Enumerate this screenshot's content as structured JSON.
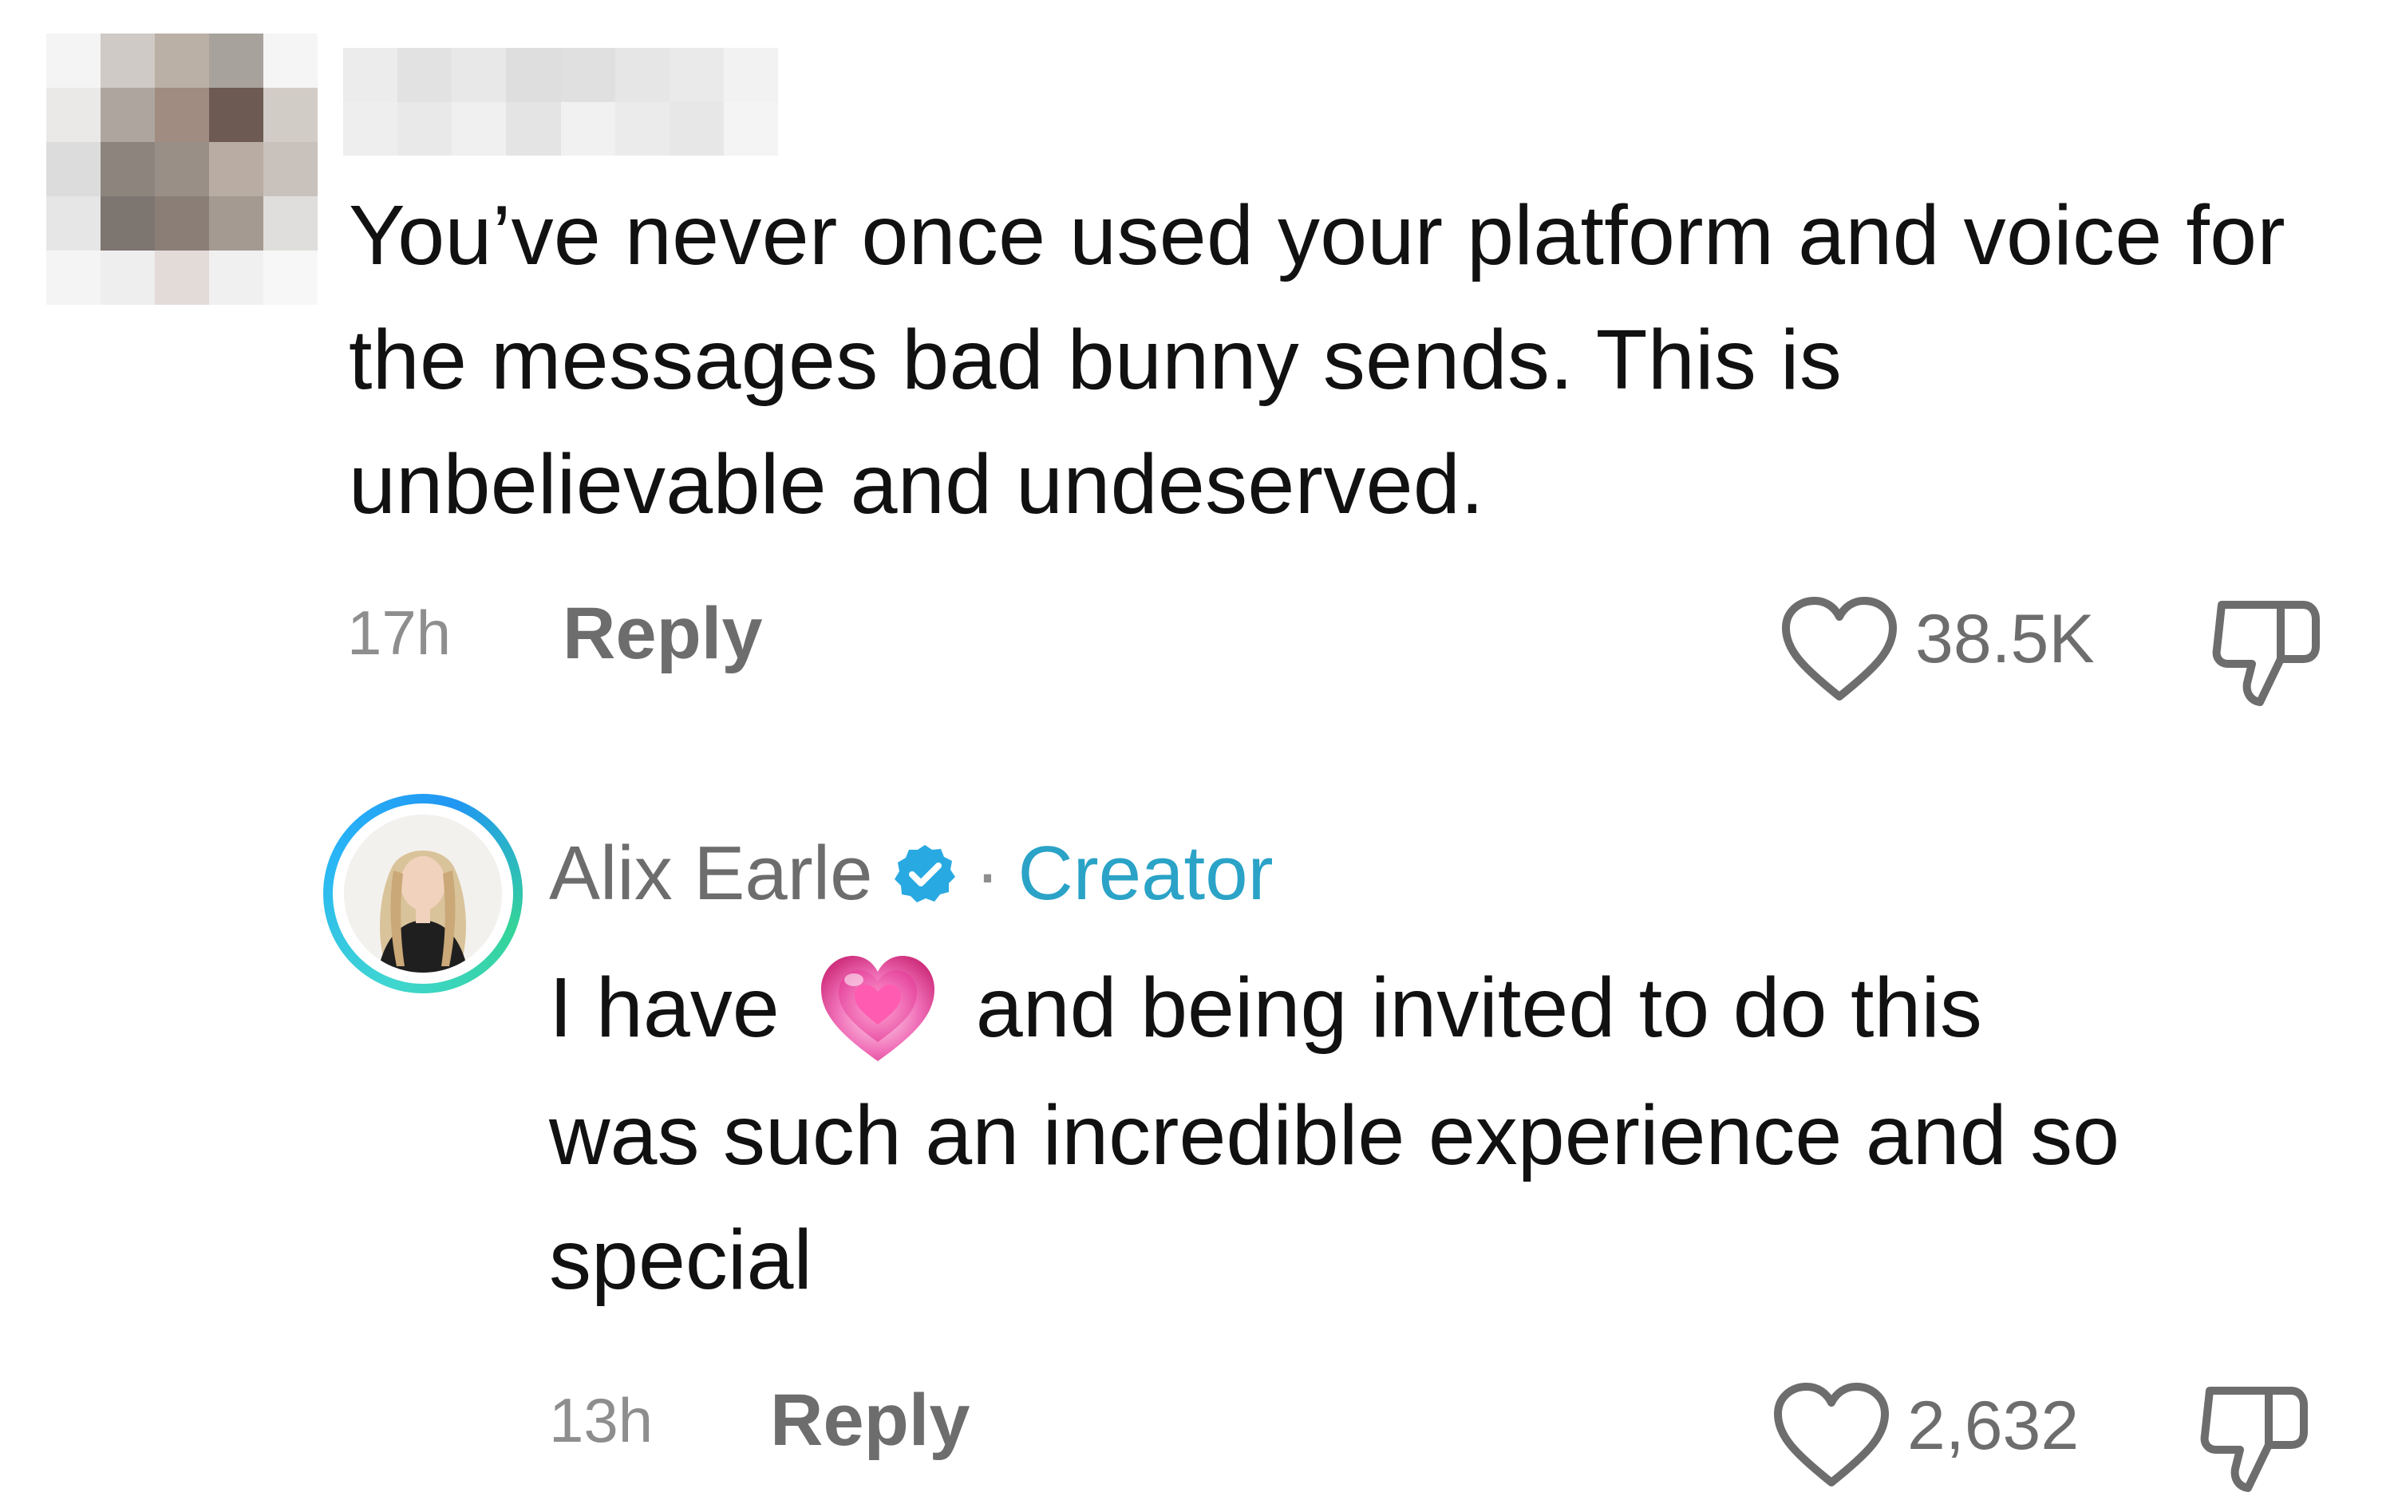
{
  "comments": [
    {
      "author": "",
      "text": "You’ve never once used your platform and voice for the messages bad bunny sends. This is unbelievable and undeserved.",
      "time": "17h",
      "reply_label": "Reply",
      "like_count": "38.5K"
    },
    {
      "author": "Alix Earle",
      "verified": true,
      "badge_label": "Creator",
      "separator": "·",
      "text_before_emoji": "I have",
      "emoji": "growing-heart",
      "text_after_emoji": "and being invited to do this",
      "text_rest": "was such an incredible experience and so special",
      "time": "13h",
      "reply_label": "Reply",
      "like_count": "2,632"
    }
  ],
  "icons": {
    "like": "heart-outline-icon",
    "dislike": "thumbs-down-icon",
    "verified": "verified-badge-icon"
  },
  "colors": {
    "text_primary": "#111111",
    "text_secondary": "#6d6d6d",
    "creator_accent": "#2aa3c7",
    "verified_blue": "#29a9e1",
    "avatar_ring": "#2fbfd6"
  }
}
